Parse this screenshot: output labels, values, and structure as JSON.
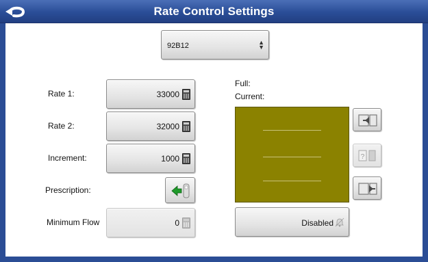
{
  "window": {
    "title": "Rate Control Settings"
  },
  "product_select": {
    "value": "92B12",
    "arrows": "▲▼"
  },
  "rates": [
    {
      "label": "Rate 1:",
      "value": "33000"
    },
    {
      "label": "Rate 2:",
      "value": "32000"
    },
    {
      "label": "Increment:",
      "value": "1000"
    }
  ],
  "prescription": {
    "label": "Prescription:"
  },
  "minimum_flow": {
    "label": "Minimum Flow",
    "value": "0"
  },
  "status": {
    "full_label": "Full:",
    "current_label": "Current:"
  },
  "alarm": {
    "label": "Disabled"
  },
  "colors": {
    "titlebar": "#2a4d97",
    "map_fill": "#8b8200",
    "arrow_green": "#1f9a2a"
  },
  "icons": {
    "back": "back-arrow-icon",
    "calculator": "calculator-icon",
    "prescription": "prescription-import-icon",
    "bell": "bell-icon"
  }
}
